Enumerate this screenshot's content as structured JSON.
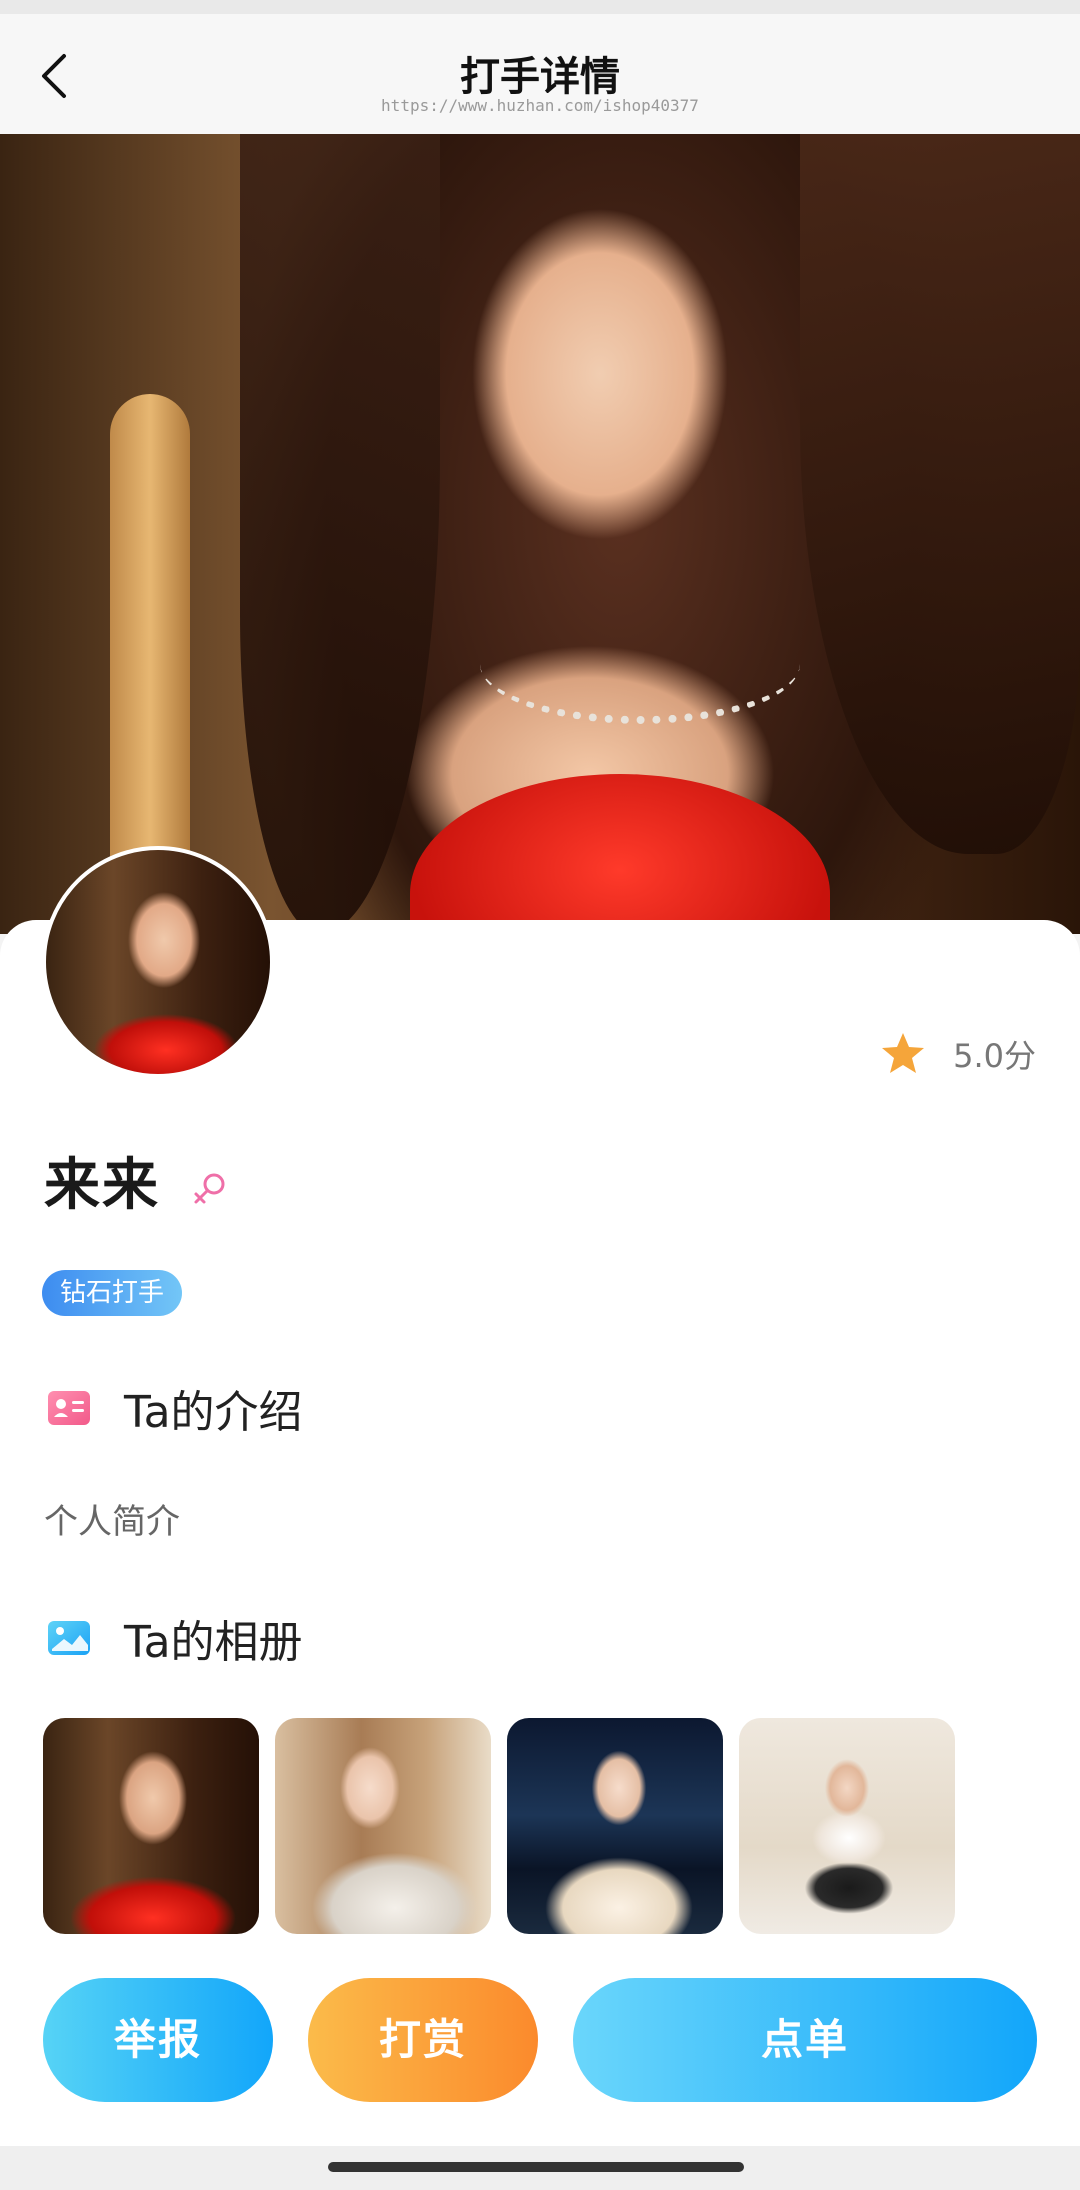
{
  "nav": {
    "title": "打手详情",
    "watermark": "https://www.huzhan.com/ishop40377"
  },
  "profile": {
    "rating": "5.0分",
    "name": "来来",
    "gender": "female",
    "level_badge": "钻石打手"
  },
  "intro": {
    "title": "Ta的介绍",
    "bio": "个人简介"
  },
  "album": {
    "title": "Ta的相册",
    "photos": [
      "photo-1",
      "photo-2",
      "photo-3",
      "photo-4"
    ]
  },
  "actions": {
    "report": "举报",
    "reward": "打赏",
    "order": "点单"
  },
  "colors": {
    "star": "#f5a53a",
    "badge_gradient": [
      "#3d8cf0",
      "#73c6f7"
    ],
    "report_gradient": [
      "#56d3f6",
      "#12a6fa"
    ],
    "reward_gradient": [
      "#fbbb4a",
      "#fb8a2c"
    ],
    "order_gradient": [
      "#6ad6fb",
      "#12a6fa"
    ],
    "female_icon": "#ef6fa8"
  }
}
